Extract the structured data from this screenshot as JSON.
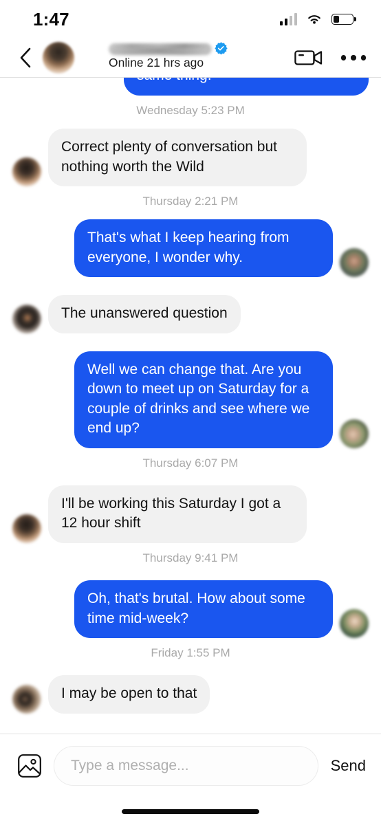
{
  "status_bar": {
    "time": "1:47",
    "signal_icon": "cellular-signal-icon",
    "wifi_icon": "wifi-icon",
    "battery_icon": "battery-icon",
    "battery_level_percent": 32
  },
  "header": {
    "back_icon": "back-chevron-icon",
    "avatar_name": "contact-avatar",
    "display_name_redacted": "",
    "verified_icon": "verified-badge-icon",
    "online_status": "Online 21 hrs ago",
    "video_call_icon": "video-camera-icon",
    "more_icon": "more-options-icon"
  },
  "conversation": {
    "clipped_top_message": "same thing.",
    "messages": [
      {
        "id": 0,
        "type": "timestamp",
        "text": "Wednesday 5:23 PM"
      },
      {
        "id": 1,
        "type": "incoming",
        "text": "Correct plenty of conversation but nothing worth the  Wild"
      },
      {
        "id": 2,
        "type": "timestamp",
        "text": "Thursday 2:21 PM"
      },
      {
        "id": 3,
        "type": "outgoing",
        "text": "That's what I keep hearing from everyone, I wonder why."
      },
      {
        "id": 4,
        "type": "incoming",
        "text": "The unanswered question"
      },
      {
        "id": 5,
        "type": "outgoing",
        "text": "Well we can change that. Are you down to meet up on Saturday for a couple of drinks and see where we end up?"
      },
      {
        "id": 6,
        "type": "timestamp",
        "text": "Thursday 6:07 PM"
      },
      {
        "id": 7,
        "type": "incoming",
        "text": "I'll be working this Saturday I got a 12 hour shift"
      },
      {
        "id": 8,
        "type": "timestamp",
        "text": "Thursday 9:41 PM"
      },
      {
        "id": 9,
        "type": "outgoing",
        "text": "Oh, that's brutal. How about some time mid-week?"
      },
      {
        "id": 10,
        "type": "timestamp",
        "text": "Friday 1:55 PM"
      },
      {
        "id": 11,
        "type": "incoming",
        "text": "I may be open to that"
      }
    ]
  },
  "composer": {
    "photo_icon": "image-attachment-icon",
    "input_value": "",
    "input_placeholder": "Type a message...",
    "send_label": "Send"
  },
  "colors": {
    "outgoing_bubble": "#1a56ef",
    "incoming_bubble": "#f1f1f1",
    "timestamp_text": "#a9a9a9",
    "verified_badge": "#1d9bf0",
    "text_primary": "#121212"
  }
}
